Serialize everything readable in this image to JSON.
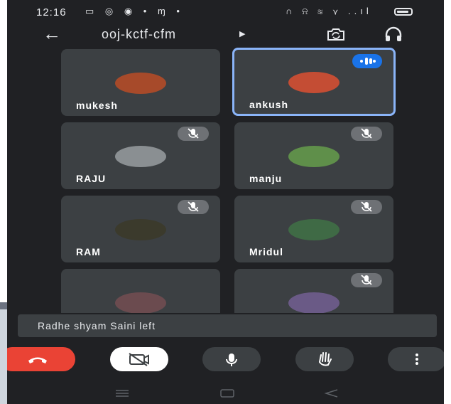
{
  "status_bar": {
    "time": "12:16",
    "left_icons": "▭ ◎ ◉ • ɱ •",
    "right_icons": "∩ ⍾ ≋ ⋎ ..ıl"
  },
  "meeting": {
    "code": "ooj-kctf-cfm"
  },
  "participants": [
    {
      "name": "mukesh",
      "muted": false,
      "speaking": false,
      "avatar_color": "#a74a2a"
    },
    {
      "name": "ankush",
      "muted": false,
      "speaking": true,
      "avatar_color": "#c44d34"
    },
    {
      "name": "RAJU",
      "muted": true,
      "speaking": false,
      "avatar_color": "#8a8f92"
    },
    {
      "name": "manju",
      "muted": true,
      "speaking": false,
      "avatar_color": "#5f8f4a"
    },
    {
      "name": "RAM",
      "muted": true,
      "speaking": false,
      "avatar_color": "#3b3a2c"
    },
    {
      "name": "Mridul",
      "muted": true,
      "speaking": false,
      "avatar_color": "#3f6a45"
    },
    {
      "name": "",
      "muted": false,
      "speaking": false,
      "avatar_color": "#6b4b4f"
    },
    {
      "name": "",
      "muted": true,
      "speaking": false,
      "avatar_color": "#6a5a86"
    }
  ],
  "notification": "Radhe shyam Saini left",
  "colors": {
    "background": "#202124",
    "tile": "#3c4043",
    "end_call": "#ea4335",
    "active_border": "#8ab4f8",
    "speaking_badge": "#1a73e8"
  }
}
